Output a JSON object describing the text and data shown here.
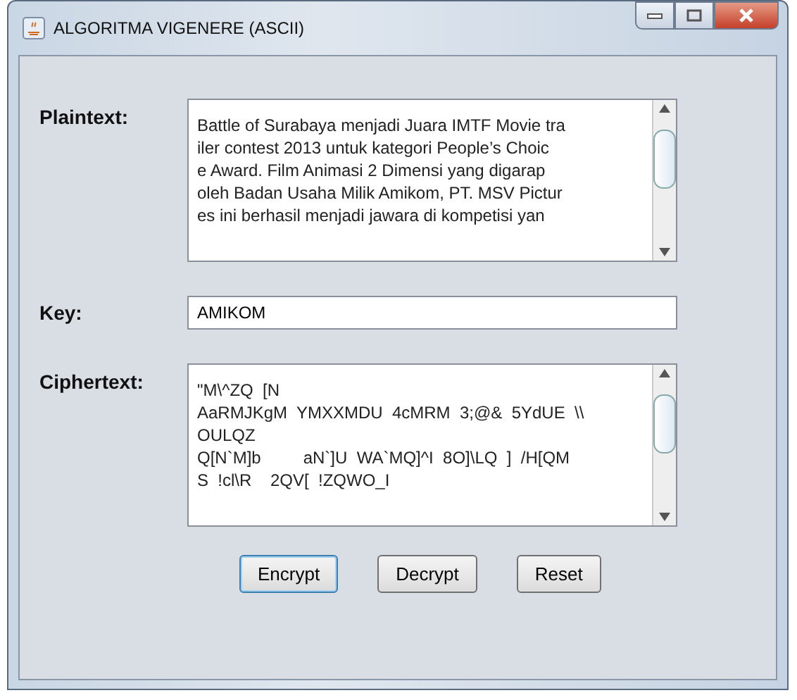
{
  "window": {
    "title": "ALGORITMA VIGENERE (ASCII)"
  },
  "plaintext": {
    "label": "Plaintext:",
    "lines": [
      "Battle of Surabaya menjadi Juara IMTF Movie tra",
      "iler contest 2013 untuk kategori People’s Choic",
      "e Award. Film Animasi 2 Dimensi yang digarap",
      "oleh Badan Usaha Milik Amikom, PT. MSV Pictur",
      "es ini berhasil menjadi jawara di kompetisi yan"
    ]
  },
  "key": {
    "label": "Key:",
    "value": "AMIKOM"
  },
  "ciphertext": {
    "label": "Ciphertext:",
    "lines": [
      "\"M\\^ZQ  [N",
      "AaRMJKgM  YMXXMDU  4cMRM  3;@&  5YdUE  \\\\",
      "OULQZ",
      "Q[N`M]b         aN`]U  WA`MQ]^I  8O]\\LQ  ]  /H[QM",
      "S  !cl\\R    2QV[  !ZQWO_I"
    ]
  },
  "buttons": [
    "Encrypt",
    "Decrypt",
    "Reset"
  ]
}
